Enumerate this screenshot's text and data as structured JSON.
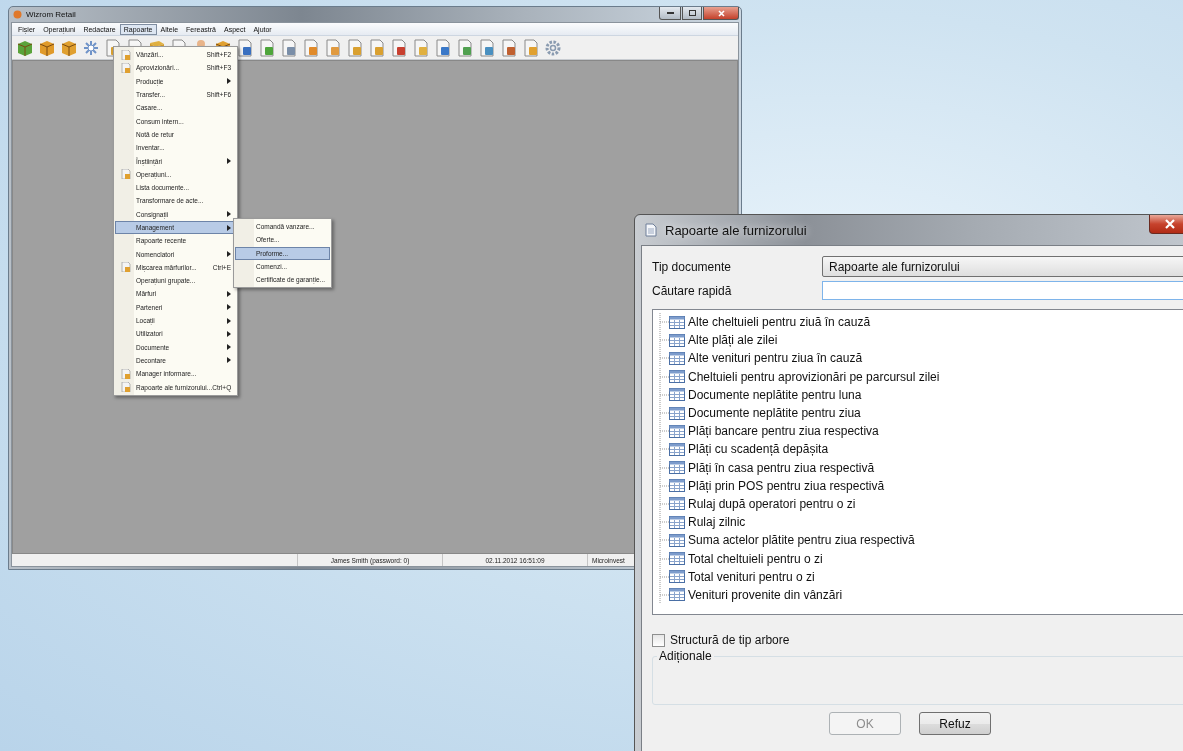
{
  "main_window": {
    "title": "Wizrom Retail",
    "menu": [
      {
        "label": "Fișier",
        "selected": false
      },
      {
        "label": "Operațiuni",
        "selected": false
      },
      {
        "label": "Redactare",
        "selected": false
      },
      {
        "label": "Rapoarte",
        "selected": true
      },
      {
        "label": "Altele",
        "selected": false
      },
      {
        "label": "Fereastră",
        "selected": false
      },
      {
        "label": "Aspect",
        "selected": false
      },
      {
        "label": "Ajutor",
        "selected": false
      }
    ],
    "status_bar": [
      "James Smith (password: 0)",
      "02.11.2012 16:51:09",
      "Microinvest"
    ]
  },
  "reports_menu": {
    "items": [
      {
        "label": "Vânzări...",
        "shortcut": "Shift+F2",
        "icon": true,
        "submenu": false,
        "selected": false
      },
      {
        "label": "Aprovizionări...",
        "shortcut": "Shift+F3",
        "icon": true,
        "submenu": false,
        "selected": false
      },
      {
        "label": "Producție",
        "icon": false,
        "submenu": true,
        "selected": false
      },
      {
        "label": "Transfer...",
        "shortcut": "Shift+F6",
        "icon": false,
        "submenu": false,
        "selected": false
      },
      {
        "label": "Casare...",
        "icon": false,
        "submenu": false,
        "selected": false
      },
      {
        "label": "Consum intern...",
        "icon": false,
        "submenu": false,
        "selected": false
      },
      {
        "label": "Notă de retur",
        "icon": false,
        "submenu": false,
        "selected": false
      },
      {
        "label": "Inventar...",
        "icon": false,
        "submenu": false,
        "selected": false
      },
      {
        "label": "Înștiințări",
        "icon": false,
        "submenu": true,
        "selected": false
      },
      {
        "label": "Operațiuni...",
        "icon": true,
        "submenu": false,
        "selected": false
      },
      {
        "label": "Lista documente...",
        "icon": false,
        "submenu": false,
        "selected": false
      },
      {
        "label": "Transformare de acte...",
        "icon": false,
        "submenu": false,
        "selected": false
      },
      {
        "label": "Consignații",
        "icon": false,
        "submenu": true,
        "selected": false
      },
      {
        "label": "Management",
        "icon": false,
        "submenu": true,
        "selected": true
      },
      {
        "label": "Rapoarte recente",
        "icon": false,
        "submenu": false,
        "selected": false
      },
      {
        "label": "Nomenclatori",
        "icon": false,
        "submenu": true,
        "selected": false
      },
      {
        "label": "Mișcarea mărfurilor...",
        "shortcut": "Ctrl+E",
        "icon": true,
        "submenu": false,
        "selected": false
      },
      {
        "label": "Operațiuni grupate...",
        "icon": false,
        "submenu": false,
        "selected": false
      },
      {
        "label": "Mărfuri",
        "icon": false,
        "submenu": true,
        "selected": false
      },
      {
        "label": "Parteneri",
        "icon": false,
        "submenu": true,
        "selected": false
      },
      {
        "label": "Locații",
        "icon": false,
        "submenu": true,
        "selected": false
      },
      {
        "label": "Utilizatori",
        "icon": false,
        "submenu": true,
        "selected": false
      },
      {
        "label": "Documente",
        "icon": false,
        "submenu": true,
        "selected": false
      },
      {
        "label": "Decontare",
        "icon": false,
        "submenu": true,
        "selected": false
      },
      {
        "label": "Manager informare...",
        "icon": true,
        "submenu": false,
        "selected": false
      },
      {
        "label": "Rapoarte ale furnizorului...",
        "shortcut": "Ctrl+Q",
        "icon": true,
        "submenu": false,
        "selected": false
      }
    ]
  },
  "management_submenu": {
    "items": [
      {
        "label": "Comandă vanzare...",
        "selected": false
      },
      {
        "label": "Oferte...",
        "selected": false
      },
      {
        "label": "Proforme...",
        "selected": true
      },
      {
        "label": "Comenzi...",
        "selected": false
      },
      {
        "label": "Certificate de garanție...",
        "selected": false
      }
    ]
  },
  "dialog": {
    "title": "Rapoarte ale furnizorului",
    "document_type": {
      "label": "Tip documente",
      "value": "Rapoarte ale furnizorului"
    },
    "quick_search": {
      "label": "Căutare rapidă"
    },
    "reports": [
      "Alte cheltuieli pentru ziuă în cauză",
      "Alte plăți ale zilei",
      "Alte venituri pentru ziua în cauză",
      "Cheltuieli pentru aprovizionări pe parcursul zilei",
      "Documente neplătite pentru luna",
      "Documente neplătite pentru ziua",
      "Plăți bancare pentru ziua respectiva",
      "Plăți cu scadență depășita",
      "Plăți în casa pentru ziua respectivă",
      "Plăți prin POS pentru ziua respectivă",
      "Rulaj după operatori pentru o zi",
      "Rulaj zilnic",
      "Suma actelor plătite pentru ziua respectivă",
      "Total cheltuieli pentru o zi",
      "Total venituri pentru o zi",
      "Venituri provenite din vânzări"
    ],
    "tree_structure": {
      "label": "Structură de tip arbore",
      "checked": false
    },
    "additional": {
      "label": "Adiționale"
    },
    "buttons": [
      {
        "label": "OK",
        "disabled": true
      },
      {
        "label": "Refuz",
        "disabled": false
      }
    ]
  }
}
